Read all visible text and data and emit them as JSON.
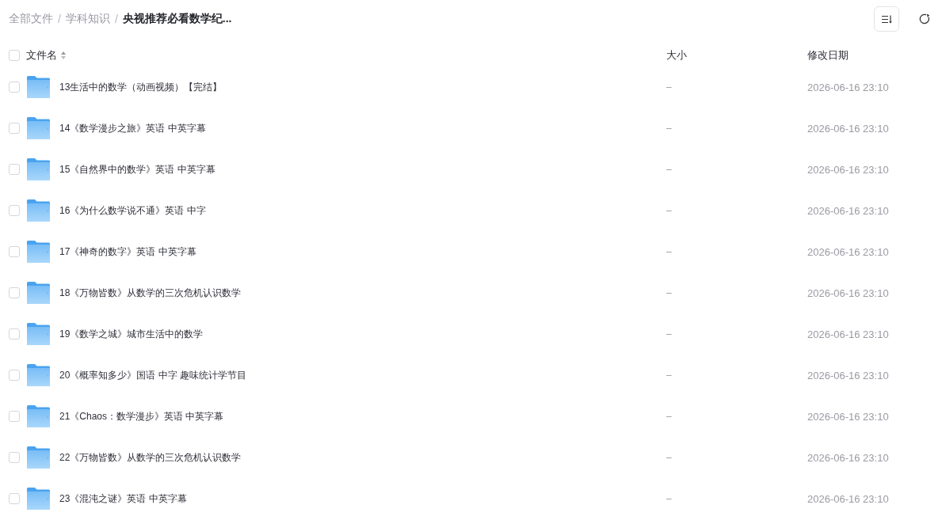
{
  "breadcrumb": [
    {
      "kind": "crumb",
      "label": "全部文件",
      "current": false
    },
    {
      "kind": "separator",
      "label": "/"
    },
    {
      "kind": "crumb",
      "label": "学科知识",
      "current": false
    },
    {
      "kind": "separator",
      "label": "/"
    },
    {
      "kind": "crumb",
      "label": "央视推荐必看数学纪...",
      "current": true
    }
  ],
  "toolbar": [
    {
      "kind": "sort"
    },
    {
      "kind": "refresh"
    }
  ],
  "table": {
    "select_all": {
      "checked": false
    },
    "columns": [
      {
        "label": "文件名",
        "sortable": true
      },
      {
        "label": "大小",
        "sortable": false
      },
      {
        "label": "修改日期",
        "sortable": false
      }
    ],
    "rows": [
      {
        "kind": "folder",
        "checked": false,
        "name": "13生活中的数学（动画视频）【完结】",
        "size": "–",
        "modified": "2026-06-16 23:10"
      },
      {
        "kind": "folder",
        "checked": false,
        "name": "14《数学漫步之旅》英语 中英字幕",
        "size": "–",
        "modified": "2026-06-16 23:10"
      },
      {
        "kind": "folder",
        "checked": false,
        "name": "15《自然界中的数学》英语 中英字幕",
        "size": "–",
        "modified": "2026-06-16 23:10"
      },
      {
        "kind": "folder",
        "checked": false,
        "name": "16《为什么数学说不通》英语 中字",
        "size": "–",
        "modified": "2026-06-16 23:10"
      },
      {
        "kind": "folder",
        "checked": false,
        "name": "17《神奇的数字》英语 中英字幕",
        "size": "–",
        "modified": "2026-06-16 23:10"
      },
      {
        "kind": "folder",
        "checked": false,
        "name": "18《万物皆数》从数学的三次危机认识数学",
        "size": "–",
        "modified": "2026-06-16 23:10"
      },
      {
        "kind": "folder",
        "checked": false,
        "name": "19《数学之城》城市生活中的数学",
        "size": "–",
        "modified": "2026-06-16 23:10"
      },
      {
        "kind": "folder",
        "checked": false,
        "name": "20《概率知多少》国语 中字 趣味统计学节目",
        "size": "–",
        "modified": "2026-06-16 23:10"
      },
      {
        "kind": "folder",
        "checked": false,
        "name": "21《Chaos：数学漫步》英语 中英字幕",
        "size": "–",
        "modified": "2026-06-16 23:10"
      },
      {
        "kind": "folder",
        "checked": false,
        "name": "22《万物皆数》从数学的三次危机认识数学",
        "size": "–",
        "modified": "2026-06-16 23:10"
      },
      {
        "kind": "folder",
        "checked": false,
        "name": "23《混沌之谜》英语 中英字幕",
        "size": "–",
        "modified": "2026-06-16 23:10"
      }
    ]
  }
}
